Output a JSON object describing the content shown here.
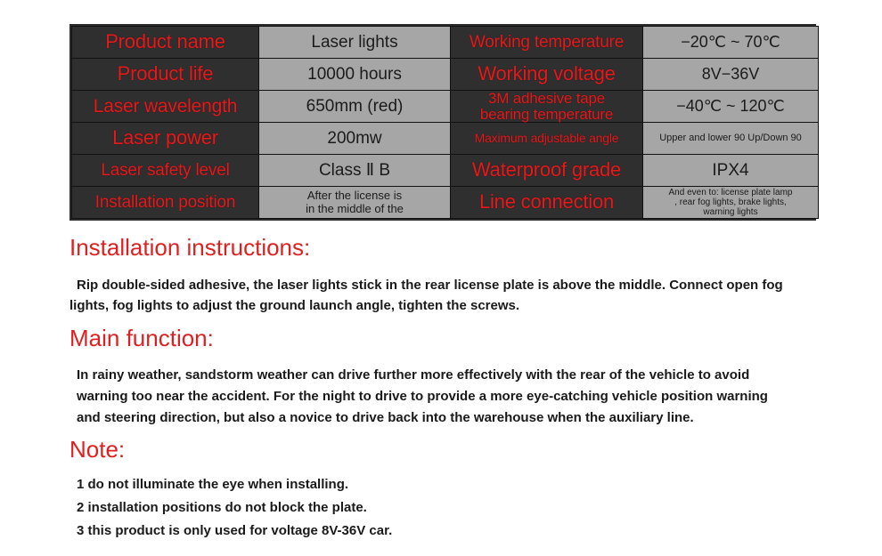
{
  "spec_table": {
    "rows": [
      {
        "left_label": "Product name",
        "left_value": "Laser lights",
        "right_label": "Working temperature",
        "right_value": "−20℃ ~ 70℃"
      },
      {
        "left_label": "Product life",
        "left_value": "10000 hours",
        "right_label": "Working voltage",
        "right_value": "8V−36V"
      },
      {
        "left_label": "Laser wavelength",
        "left_value": "650mm (red)",
        "right_label": "3M adhesive tape bearing temperature",
        "right_label_line1": "3M adhesive tape",
        "right_label_line2": "bearing temperature",
        "right_value": "−40℃ ~ 120℃"
      },
      {
        "left_label": "Laser power",
        "left_value": "200mw",
        "right_label": "Maximum adjustable angle",
        "right_value": "Upper and lower 90 Up/Down 90"
      },
      {
        "left_label": "Laser safety level",
        "left_value": "Class Ⅱ  B",
        "right_label": "Waterproof grade",
        "right_value": "IPX4"
      },
      {
        "left_label": "Installation position",
        "left_value": "After the license is in the middle of the",
        "left_value_line1": "After the license is",
        "left_value_line2": "in the middle of the",
        "right_label": "Line connection",
        "right_value": "And even to: license plate lamp , rear fog lights, brake lights, warning lights",
        "right_value_line1": "And even to: license plate lamp",
        "right_value_line2": ", rear fog lights, brake lights,",
        "right_value_line3": "warning lights"
      }
    ]
  },
  "sections": {
    "installation": {
      "heading": "Installation instructions:",
      "body_line1": "Rip double-sided adhesive, the laser lights stick in the rear license plate is above the middle. Connect open fog",
      "body_line2": "lights, fog lights to adjust the ground launch angle, tighten the screws."
    },
    "main_function": {
      "heading": "Main function:",
      "body_line1": "In rainy weather, sandstorm weather can drive further more effectively with the rear of the vehicle to avoid",
      "body_line2": "warning too near the accident. For the night to drive to provide a more eye-catching vehicle position warning",
      "body_line3": "and steering direction, but also a novice to drive back into the warehouse when the auxiliary line."
    },
    "note": {
      "heading": "Note:",
      "items": [
        "1 do not illuminate the eye when installing.",
        "2 installation positions do not block the plate.",
        "3 this product is only used for voltage 8V-36V car."
      ]
    }
  },
  "colors": {
    "heading_red": "#e02020",
    "label_red": "#e8191b",
    "label_bg": "#2f2f2f",
    "value_bg": "#a6a6a6",
    "page_bg": "#ffffff"
  }
}
